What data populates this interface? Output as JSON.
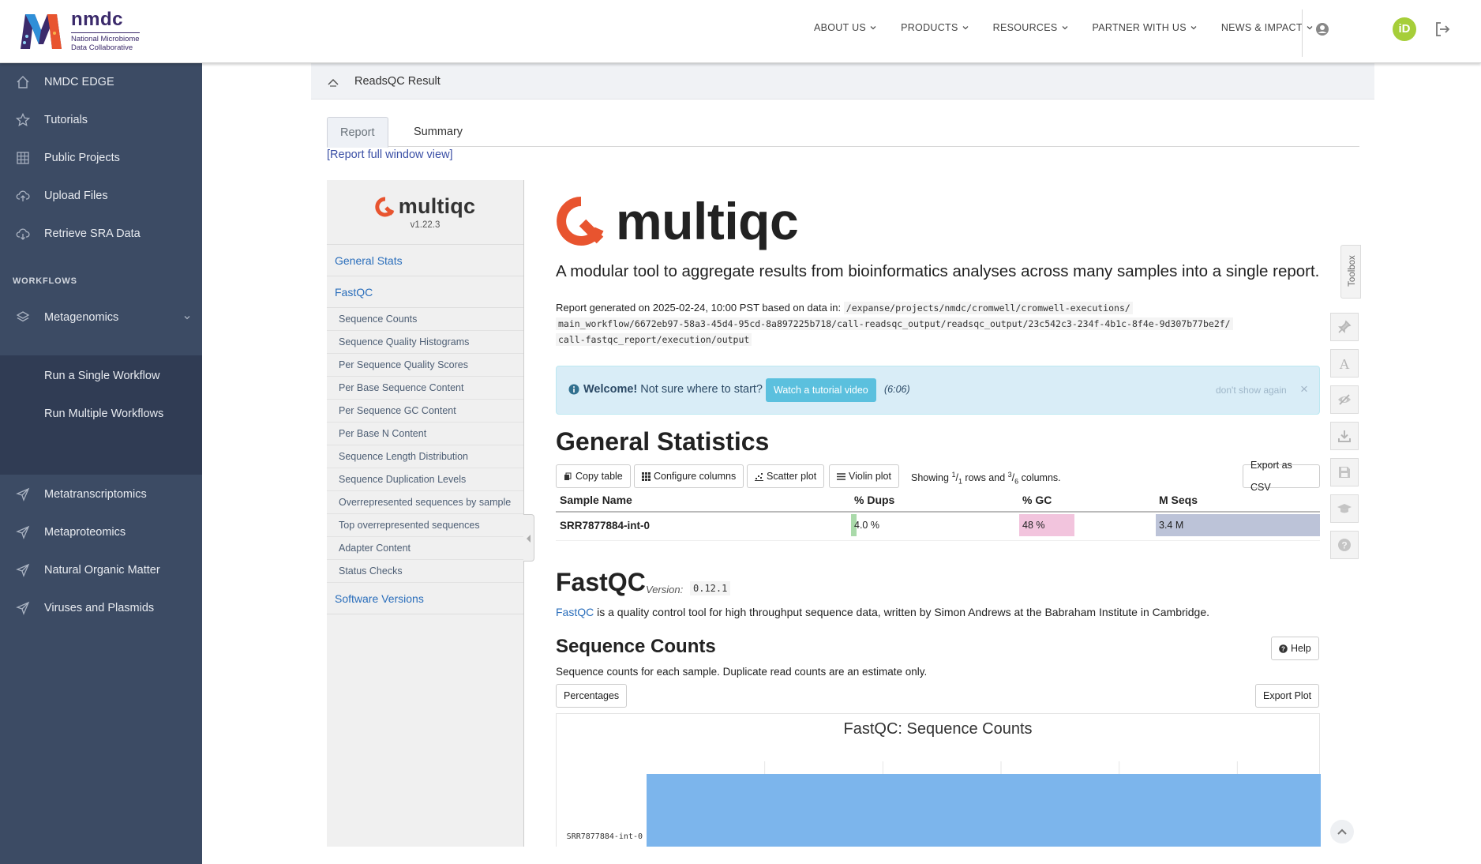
{
  "brand": {
    "name": "nmdc",
    "subtitle_line1": "National Microbiome",
    "subtitle_line2": "Data Collaborative"
  },
  "nav": [
    {
      "label": "ABOUT US"
    },
    {
      "label": "PRODUCTS"
    },
    {
      "label": "RESOURCES"
    },
    {
      "label": "PARTNER WITH US"
    },
    {
      "label": "NEWS & IMPACT"
    }
  ],
  "header": {
    "orcid": "iD"
  },
  "sidebar": {
    "items": [
      {
        "label": "NMDC EDGE",
        "icon": "home-icon"
      },
      {
        "label": "Tutorials",
        "icon": "star-icon"
      },
      {
        "label": "Public Projects",
        "icon": "grid-icon"
      },
      {
        "label": "Upload Files",
        "icon": "cloud-upload-icon"
      },
      {
        "label": "Retrieve SRA Data",
        "icon": "cloud-download-icon"
      }
    ],
    "workflows_heading": "WORKFLOWS",
    "metagenomics": "Metagenomics",
    "sub": [
      {
        "label": "Run a Single Workflow"
      },
      {
        "label": "Run Multiple Workflows"
      }
    ],
    "workflows": [
      {
        "label": "Metatranscriptomics"
      },
      {
        "label": "Metaproteomics"
      },
      {
        "label": "Natural Organic Matter"
      },
      {
        "label": "Viruses and Plasmids"
      }
    ]
  },
  "breadcrumb": {
    "title": "ReadsQC Result"
  },
  "tabs": {
    "report": "Report",
    "summary": "Summary"
  },
  "full_window_link": "[Report full window view]",
  "multiqc": {
    "logo_word": "multiqc",
    "version": "v1.22.3",
    "nav": {
      "general_stats": "General Stats",
      "fastqc": "FastQC",
      "fastqc_items": [
        "Sequence Counts",
        "Sequence Quality Histograms",
        "Per Sequence Quality Scores",
        "Per Base Sequence Content",
        "Per Sequence GC Content",
        "Per Base N Content",
        "Sequence Length Distribution",
        "Sequence Duplication Levels",
        "Overrepresented sequences by sample",
        "Top overrepresented sequences",
        "Adapter Content",
        "Status Checks"
      ],
      "software_versions": "Software Versions"
    },
    "tagline": "A modular tool to aggregate results from bioinformatics analyses across many samples into a single report.",
    "generated_prefix": "Report generated on 2025-02-24, 10:00 PST based on data in:",
    "generated_path_1": "/expanse/projects/nmdc/cromwell/cromwell-executions/",
    "generated_path_2": "main_workflow/6672eb97-58a3-45d4-95cd-8a897225b718/call-readsqc_output/readsqc_output/23c542c3-234f-4b1c-8f4e-9d307b77be2f/",
    "generated_path_3": "call-fastqc_report/execution/output",
    "welcome": {
      "bold": "Welcome!",
      "text": " Not sure where to start?",
      "button": "Watch a tutorial video",
      "time": "(6:06)",
      "dont_show": "don't show again",
      "close": "×"
    },
    "general_statistics": {
      "heading": "General Statistics",
      "buttons": {
        "copy": "Copy table",
        "configure": "Configure columns",
        "scatter": "Scatter plot",
        "violin": "Violin plot",
        "export": "Export as CSV"
      },
      "showing": {
        "prefix": "Showing ",
        "rows_num": "1",
        "rows_den": "1",
        "mid": " rows and ",
        "cols_num": "3",
        "cols_den": "6",
        "suffix": " columns."
      },
      "columns": [
        "Sample Name",
        "% Dups",
        "% GC",
        "M Seqs"
      ],
      "rows": [
        {
          "sample": "SRR7877884-int-0",
          "dups": "4.0 %",
          "dups_frac": 0.04,
          "gc": "48 %",
          "gc_frac": 0.48,
          "mseqs": "3.4 M",
          "mseqs_frac": 1.0
        }
      ]
    },
    "fastqc": {
      "heading": "FastQC",
      "version_label": "Version:",
      "version": "0.12.1",
      "link": "FastQC",
      "desc": " is a quality control tool for high throughput sequence data, written by Simon Andrews at the Babraham Institute in Cambridge."
    },
    "sequence_counts": {
      "heading": "Sequence Counts",
      "help": "Help",
      "desc": "Sequence counts for each sample. Duplicate read counts are an estimate only.",
      "percentages": "Percentages",
      "export": "Export Plot"
    },
    "toolbox": "Toolbox"
  },
  "colors": {
    "sidebar": "#3c4b64",
    "sidebar_sub": "#303c54",
    "unique_reads": "#7cb5ec",
    "duplicate_reads": "#434348",
    "dups_bar": "#aadaaa",
    "gc_bar": "#f2c4dd",
    "mseqs_bar": "#bcc3d8"
  },
  "chart_data": {
    "type": "bar",
    "orientation": "horizontal",
    "stacked": true,
    "title": "FastQC: Sequence Counts",
    "categories": [
      "SRR7877884-int-0"
    ],
    "series": [
      {
        "values": [
          3.26
        ],
        "color": "#7cb5ec"
      },
      {
        "values": [
          0.14
        ],
        "color": "#434348"
      }
    ]
  }
}
